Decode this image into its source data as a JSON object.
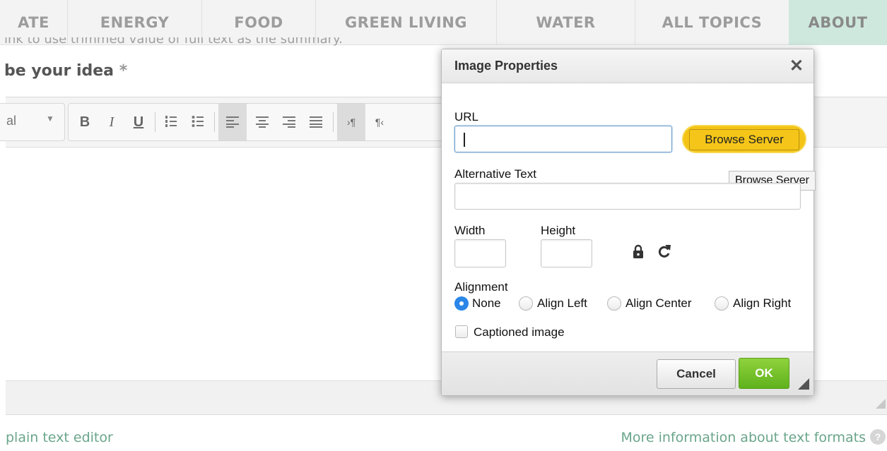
{
  "nav": {
    "tabs": [
      {
        "label": "ATE"
      },
      {
        "label": "ENERGY"
      },
      {
        "label": "FOOD"
      },
      {
        "label": "GREEN LIVING"
      },
      {
        "label": "WATER"
      },
      {
        "label": "ALL TOPICS"
      },
      {
        "label": "ABOUT"
      }
    ],
    "active_color": "#cfe8de"
  },
  "page": {
    "summary_hint": "ink to use trimmed value of full text as the summary.",
    "field_label": "be your idea",
    "required_marker": "*",
    "plain_text_link": "plain text editor",
    "formats_link": "More information about text formats",
    "help_icon": "?"
  },
  "toolbar": {
    "format_select": "al",
    "bold": "B",
    "italic": "I",
    "underline": "U"
  },
  "dialog": {
    "title": "Image Properties",
    "close_icon": "✕",
    "url_label": "URL",
    "url_value": "",
    "browse_button": "Browse Server",
    "tooltip": "Browse Server",
    "alt_label": "Alternative Text",
    "alt_value": "",
    "width_label": "Width",
    "width_value": "",
    "height_label": "Height",
    "height_value": "",
    "alignment_label": "Alignment",
    "alignment_options": [
      "None",
      "Align Left",
      "Align Center",
      "Align Right"
    ],
    "alignment_selected": "None",
    "captioned_label": "Captioned image",
    "captioned_checked": false,
    "cancel_button": "Cancel",
    "ok_button": "OK",
    "highlight_color": "#f3c315",
    "ok_color": "#6cbf24",
    "radio_selected_color": "#2b86e8"
  }
}
